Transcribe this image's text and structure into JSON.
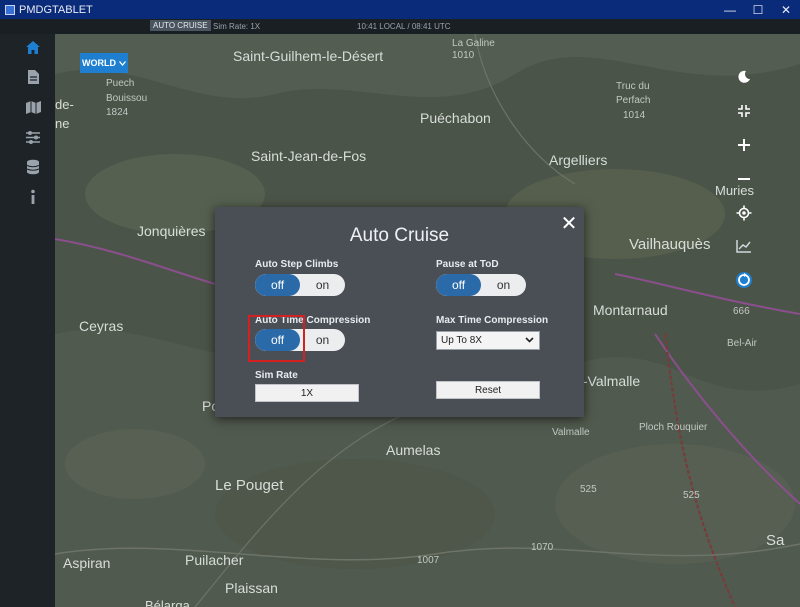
{
  "window": {
    "title": "PMDGTABLET",
    "buttons": {
      "minimize": "—",
      "maximize": "☐",
      "close": "✕"
    }
  },
  "statusbar": {
    "mode": "AUTO CRUISE",
    "sim_rate": "Sim Rate: 1X",
    "time": "10:41 LOCAL / 08:41 UTC"
  },
  "sidebar": {
    "icons": [
      "home-icon",
      "document-icon",
      "map-icon",
      "sliders-icon",
      "database-icon",
      "info-icon"
    ]
  },
  "map": {
    "world_button": "WORLD",
    "places": [
      {
        "name": "Saint-Guilhem-le-Désert",
        "id": "saint-guilhem"
      },
      {
        "name": "La Galine",
        "id": "la-galine"
      },
      {
        "name": "1010",
        "id": "alt-1010"
      },
      {
        "name": "Puech",
        "id": "puech"
      },
      {
        "name": "Bouissou",
        "id": "bouissou"
      },
      {
        "name": "1824",
        "id": "alt-1824"
      },
      {
        "name": "de-",
        "id": "de"
      },
      {
        "name": "ne",
        "id": "ne"
      },
      {
        "name": "Truc du",
        "id": "truc-du"
      },
      {
        "name": "Perfach",
        "id": "perfach"
      },
      {
        "name": "1014",
        "id": "alt-1014"
      },
      {
        "name": "Puéchabon",
        "id": "puechabon"
      },
      {
        "name": "Saint-Jean-de-Fos",
        "id": "saint-jean-de-fos"
      },
      {
        "name": "Argelliers",
        "id": "argelliers"
      },
      {
        "name": "Muries",
        "id": "muries"
      },
      {
        "name": "Jonquières",
        "id": "jonquieres"
      },
      {
        "name": "Vailhauquès",
        "id": "vailhauques"
      },
      {
        "name": "Montarnaud",
        "id": "montarnaud"
      },
      {
        "name": "Ceyras",
        "id": "ceyras"
      },
      {
        "name": "Bel-Air",
        "id": "bel-air"
      },
      {
        "name": "666",
        "id": "alt-666"
      },
      {
        "name": "t-Valmalle",
        "id": "st-valmalle"
      },
      {
        "name": "Po",
        "id": "po"
      },
      {
        "name": "Valmalle",
        "id": "valmalle"
      },
      {
        "name": "Ploch Rouquier",
        "id": "ploch-rouquier"
      },
      {
        "name": "Aumelas",
        "id": "aumelas"
      },
      {
        "name": "Le Pouget",
        "id": "le-pouget"
      },
      {
        "name": "525",
        "id": "alt-525"
      },
      {
        "name": "525",
        "id": "alt-525b"
      },
      {
        "name": "1070",
        "id": "alt-1070"
      },
      {
        "name": "1007",
        "id": "alt-1007"
      },
      {
        "name": "Sa",
        "id": "sa"
      },
      {
        "name": "Aspiran",
        "id": "aspiran"
      },
      {
        "name": "Puilacher",
        "id": "puilacher"
      },
      {
        "name": "Plaissan",
        "id": "plaissan"
      },
      {
        "name": "Bélarga",
        "id": "belarga"
      }
    ],
    "controls": [
      "moon-icon",
      "fit-screen-icon",
      "zoom-in-icon",
      "zoom-out-icon",
      "locate-icon",
      "chart-icon",
      "rotate-icon"
    ]
  },
  "modal": {
    "title": "Auto Cruise",
    "close": "✕",
    "auto_step_climbs": {
      "label": "Auto Step Climbs",
      "off": "off",
      "on": "on",
      "value": "off"
    },
    "pause_at_tod": {
      "label": "Pause at ToD",
      "off": "off",
      "on": "on",
      "value": "off"
    },
    "auto_time_compression": {
      "label": "Auto Time Compression",
      "off": "off",
      "on": "on",
      "value": "off"
    },
    "max_time_compression": {
      "label": "Max Time Compression",
      "value": "Up To 8X"
    },
    "sim_rate": {
      "label": "Sim Rate",
      "value": "1X"
    },
    "reset": "Reset"
  },
  "colors": {
    "accent": "#1e7fd0",
    "toggle_active": "#2a6aa8",
    "modal_bg": "#4a4f56",
    "highlight": "#d42020"
  }
}
